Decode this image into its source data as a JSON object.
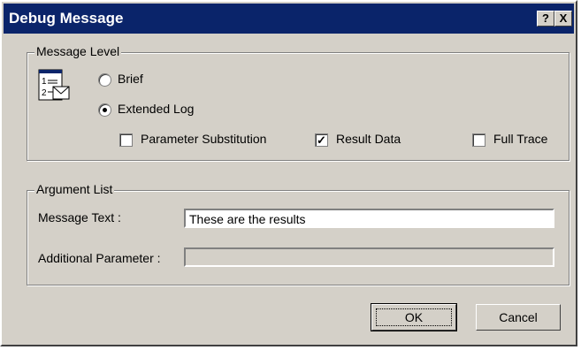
{
  "window": {
    "title": "Debug Message"
  },
  "titlebar_buttons": {
    "help": "?",
    "close": "X"
  },
  "message_level": {
    "legend": "Message Level",
    "options": [
      {
        "label": "Brief",
        "selected": false
      },
      {
        "label": "Extended Log",
        "selected": true
      }
    ],
    "checkboxes": [
      {
        "label": "Parameter Substitution",
        "checked": false
      },
      {
        "label": "Result Data",
        "checked": true
      },
      {
        "label": "Full Trace",
        "checked": false
      }
    ]
  },
  "argument_list": {
    "legend": "Argument List",
    "message_text_label": "Message Text :",
    "message_text_value": "These are the results",
    "additional_parameter_label": "Additional Parameter :",
    "additional_parameter_value": ""
  },
  "buttons": {
    "ok": "OK",
    "cancel": "Cancel"
  },
  "colors": {
    "titlebar": "#0a246a",
    "face": "#d4d0c8"
  },
  "icons": {
    "message_level": "numbered-list-envelope-icon"
  }
}
